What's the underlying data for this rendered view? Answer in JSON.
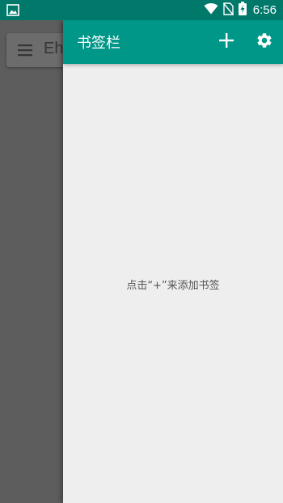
{
  "status_bar": {
    "time": "6:56",
    "icons": [
      "image-notification-icon",
      "wifi-icon",
      "no-sim-icon",
      "battery-charging-icon"
    ]
  },
  "background_app": {
    "title": "Eh",
    "menu_icon": "menu-icon"
  },
  "drawer": {
    "title": "书签栏",
    "add_icon": "add-icon",
    "settings_icon": "gear-icon",
    "empty_hint": "点击“+”来添加书签"
  },
  "colors": {
    "status_bar": "#00796b",
    "toolbar": "#009688",
    "drawer_bg": "#eeeeee",
    "scrim": "#5b5b5b"
  }
}
